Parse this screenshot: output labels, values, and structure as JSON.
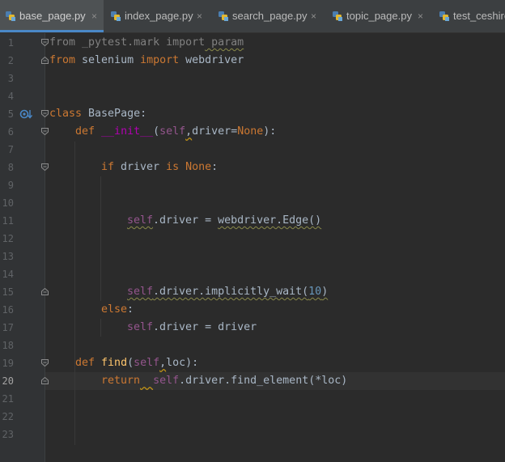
{
  "tabs": [
    {
      "label": "base_page.py",
      "close": "×",
      "active": true
    },
    {
      "label": "index_page.py",
      "close": "×",
      "active": false
    },
    {
      "label": "search_page.py",
      "close": "×",
      "active": false
    },
    {
      "label": "topic_page.py",
      "close": "×",
      "active": false
    },
    {
      "label": "test_ceshire",
      "close": "",
      "active": false
    }
  ],
  "current_line": 20,
  "line_numbers": [
    "1",
    "2",
    "3",
    "4",
    "5",
    "6",
    "7",
    "8",
    "9",
    "10",
    "11",
    "12",
    "13",
    "14",
    "15",
    "16",
    "17",
    "18",
    "19",
    "20",
    "21",
    "22",
    "23"
  ],
  "code": {
    "l1": {
      "a": "from",
      "b": " _pytest.mark ",
      "c": "import",
      "d": " param"
    },
    "l2": {
      "a": "from",
      "b": " selenium ",
      "c": "import",
      "d": " webdriver"
    },
    "l5": {
      "a": "class",
      "b": " BasePage:"
    },
    "l6": {
      "a": "def",
      "b": " ",
      "c": "__init__",
      "d": "(",
      "e": "self",
      "f": ",",
      "g": "driver=",
      "h": "None",
      "i": "):"
    },
    "l8": {
      "a": "if",
      "b": " driver ",
      "c": "is",
      "d": " ",
      "e": "None",
      "f": ":"
    },
    "l11": {
      "a": "self",
      "b": ".driver = ",
      "c": "webdriver.Edge()"
    },
    "l15": {
      "a": "self",
      "b": ".driver.implicitly_wait(",
      "c": "10",
      "d": ")"
    },
    "l16": {
      "a": "else",
      "b": ":"
    },
    "l17": {
      "a": "self",
      "b": ".driver = driver"
    },
    "l19": {
      "a": "def",
      "b": " ",
      "c": "find",
      "d": "(",
      "e": "self",
      "f": ",",
      "g": "loc):"
    },
    "l20": {
      "a": "return",
      "b": "  ",
      "c": "self",
      "d": ".driver.find_element(*loc)"
    }
  },
  "colors": {
    "background": "#2b2b2b",
    "keyword": "#cc7832",
    "function": "#ffc66d",
    "self": "#94558d",
    "magic": "#b200b2",
    "number": "#6897bb",
    "text": "#a9b7c6",
    "unused": "#808080",
    "tab_accent": "#4a88c7"
  },
  "icons": {
    "tab_file": "python-file-icon",
    "gutter_override": "overridden-method-icon",
    "fold": "fold-marker-icon"
  }
}
